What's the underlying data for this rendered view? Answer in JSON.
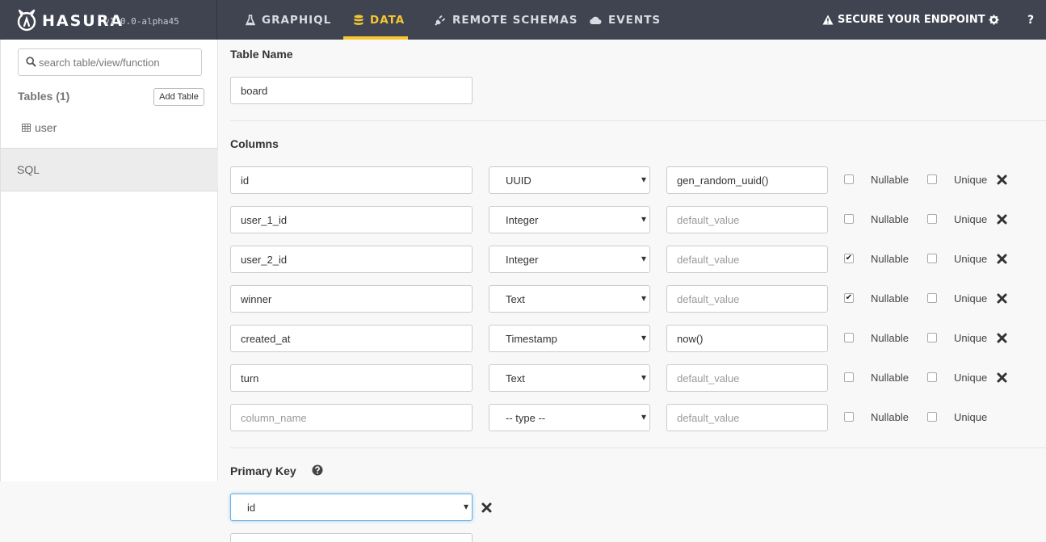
{
  "brand": {
    "name": "HASURA",
    "version": "v1.0.0-alpha45"
  },
  "nav": {
    "items": [
      {
        "label": "GRAPHIQL",
        "icon": "flask-icon"
      },
      {
        "label": "DATA",
        "icon": "database-icon",
        "active": true
      },
      {
        "label": "REMOTE SCHEMAS",
        "icon": "plug-icon"
      },
      {
        "label": "EVENTS",
        "icon": "cloud-icon"
      }
    ],
    "secure_label": "SECURE YOUR ENDPOINT",
    "help_label": "?"
  },
  "sidebar": {
    "search_placeholder": "search table/view/function",
    "tables_heading": "Tables (1)",
    "add_table_label": "Add Table",
    "tables": [
      {
        "name": "user"
      }
    ],
    "sql_label": "SQL"
  },
  "form": {
    "table_name_label": "Table Name",
    "table_name_value": "board",
    "columns_label": "Columns",
    "nullable_label": "Nullable",
    "unique_label": "Unique",
    "default_placeholder": "default_value",
    "column_name_placeholder": "column_name",
    "columns": [
      {
        "name": "id",
        "type": "UUID",
        "default": "gen_random_uuid()",
        "nullable": false,
        "unique": false
      },
      {
        "name": "user_1_id",
        "type": "Integer",
        "default": "",
        "nullable": false,
        "unique": false
      },
      {
        "name": "user_2_id",
        "type": "Integer",
        "default": "",
        "nullable": true,
        "unique": false
      },
      {
        "name": "winner",
        "type": "Text",
        "default": "",
        "nullable": true,
        "unique": false
      },
      {
        "name": "created_at",
        "type": "Timestamp",
        "default": "now()",
        "nullable": false,
        "unique": false
      },
      {
        "name": "turn",
        "type": "Text",
        "default": "",
        "nullable": false,
        "unique": false
      }
    ],
    "new_column": {
      "type": "-- type --"
    },
    "primary_key_label": "Primary Key",
    "primary_key_value": "id"
  },
  "colors": {
    "topbar": "#3f4450",
    "accent": "#f6c633"
  }
}
